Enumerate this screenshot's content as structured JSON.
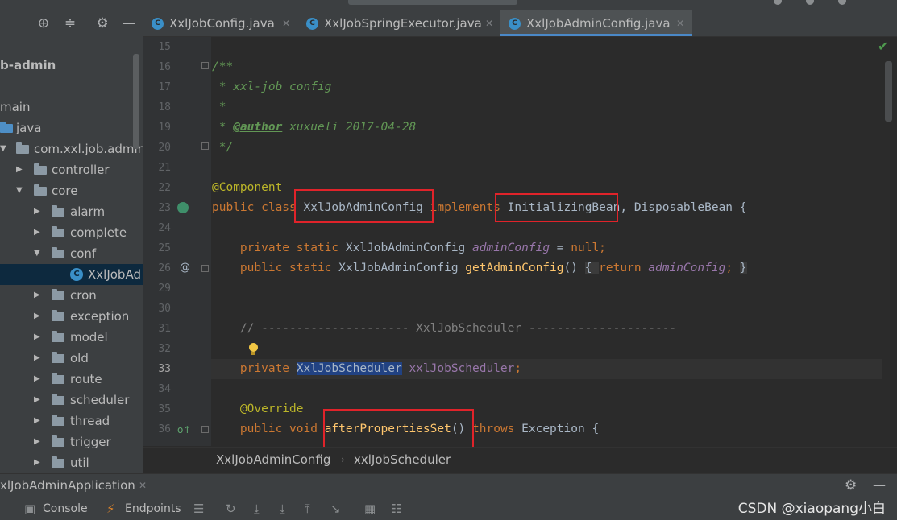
{
  "project": {
    "root_label": "b-admin",
    "items": [
      {
        "label": "main"
      },
      {
        "label": "java"
      },
      {
        "label": "com.xxl.job.admin"
      },
      {
        "label": "controller"
      },
      {
        "label": "core"
      },
      {
        "label": "alarm"
      },
      {
        "label": "complete"
      },
      {
        "label": "conf"
      },
      {
        "label": "XxlJobAd"
      },
      {
        "label": "cron"
      },
      {
        "label": "exception"
      },
      {
        "label": "model"
      },
      {
        "label": "old"
      },
      {
        "label": "route"
      },
      {
        "label": "scheduler"
      },
      {
        "label": "thread"
      },
      {
        "label": "trigger"
      },
      {
        "label": "util"
      }
    ]
  },
  "tabs": [
    {
      "label": "XxlJobConfig.java"
    },
    {
      "label": "XxlJobSpringExecutor.java"
    },
    {
      "label": "XxlJobAdminConfig.java"
    }
  ],
  "editor": {
    "line_numbers": [
      "15",
      "16",
      "17",
      "18",
      "19",
      "20",
      "21",
      "22",
      "23",
      "24",
      "25",
      "26",
      "29",
      "30",
      "31",
      "32",
      "33",
      "34",
      "35",
      "36"
    ],
    "lines": {
      "l16": "/**",
      "l17": " * xxl-job config",
      "l18": " *",
      "l19_a": " * ",
      "l19_tag": "@author",
      "l19_b": " xuxueli 2017-04-28",
      "l20": " */",
      "l22": "@Component",
      "l23_kw": "public class ",
      "l23_cls": "XxlJobAdminConfig",
      "l23_impl": " implements ",
      "l23_if1": "InitializingBean",
      "l23_rest": ", DisposableBean {",
      "l25_kw": "    private static ",
      "l25_type": "XxlJobAdminConfig ",
      "l25_fld": "adminConfig",
      "l25_eq": " = ",
      "l25_null": "null",
      "l25_end": ";",
      "l26_kw": "    public static ",
      "l26_type": "XxlJobAdminConfig ",
      "l26_fn": "getAdminConfig",
      "l26_p": "() ",
      "l26_b1": "{ ",
      "l26_ret": "return ",
      "l26_fld": "adminConfig",
      "l26_semi": "; ",
      "l26_b2": "}",
      "l31": "    // --------------------- XxlJobScheduler ---------------------",
      "l33_kw": "    private ",
      "l33_type": "XxlJobScheduler",
      "l33_fld": " xxlJobScheduler",
      "l33_end": ";",
      "l35": "    @Override",
      "l36_kw": "    public void ",
      "l36_fn": "afterPropertiesSet",
      "l36_p": "() ",
      "l36_throws": "throws ",
      "l36_rest": "Exception {"
    }
  },
  "breadcrumb": {
    "first": "XxlJobAdminConfig",
    "second": "xxlJobScheduler"
  },
  "run": {
    "title": "xlJobAdminApplication"
  },
  "bottom": {
    "console": "Console",
    "endpoints": "Endpoints"
  },
  "watermark": "CSDN @xiaopang小白",
  "colors": {
    "highlight_box": "#e0232a",
    "selection": "#214283",
    "accent_tab": "#4a88c7"
  }
}
